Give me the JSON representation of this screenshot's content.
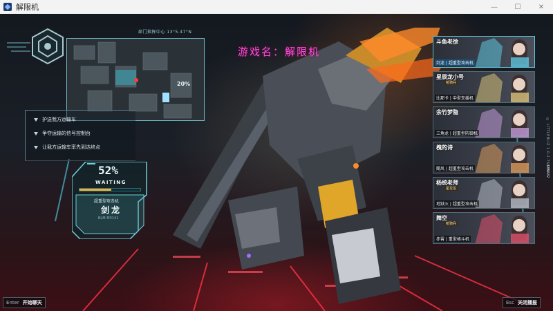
{
  "window": {
    "title": "解限机"
  },
  "game_title": "游戏名：解限机",
  "minimap": {
    "header": "部门指挥中心  13°5.47°N",
    "percent": "20%"
  },
  "objectives": [
    "护送我方运输车",
    "争夺运输的信号控制台",
    "让我方运输车率先到达终点"
  ],
  "status": {
    "percent_label": "52%",
    "progress": 0.52,
    "waiting": "WAITING",
    "ship_subtitle": "超重型攻击机",
    "ship_name": "剑龙",
    "ship_code": "BLM-M3141"
  },
  "players": [
    {
      "name": "斗鱼老徐",
      "tag": "",
      "mech": "剑龙 | 超重型攻击机",
      "active": true,
      "accent": "#5fc6e0"
    },
    {
      "name": "星辰龙小号",
      "tag": "枪骑兵",
      "mech": "比那卡 | 中型支援机",
      "active": false,
      "accent": "#d9c27a"
    },
    {
      "name": "余竹梦隐",
      "tag": "",
      "mech": "三角龙 | 超重型防御机",
      "active": false,
      "accent": "#c39bd8"
    },
    {
      "name": "槐的诗",
      "tag": "",
      "mech": "飓风 | 超重型攻击机",
      "active": false,
      "accent": "#d99a5a"
    },
    {
      "name": "杨统老师",
      "tag": "星龙龙",
      "mech": "地狱火 | 超重型攻击机",
      "active": false,
      "accent": "#b6bcc6"
    },
    {
      "name": "舞空",
      "tag": "枪骑兵",
      "mech": "赤霄 | 重型格斗机",
      "active": false,
      "accent": "#e0506a"
    }
  ],
  "side_text": "© LITTLEBLIZ  1.0.2.76698",
  "side_text_2": "1E5A82",
  "buttons": {
    "chat": {
      "key": "Enter",
      "label": "开始聊天"
    },
    "close": {
      "key": "Esc",
      "label": "关闭播报"
    }
  },
  "window_buttons": {
    "minimize": "—",
    "maximize": "☐",
    "close": "✕"
  },
  "colors": {
    "hud_cyan": "#6fb9c6",
    "progress_orange": "#f2b134",
    "title_pink": "#ff4fd6"
  }
}
